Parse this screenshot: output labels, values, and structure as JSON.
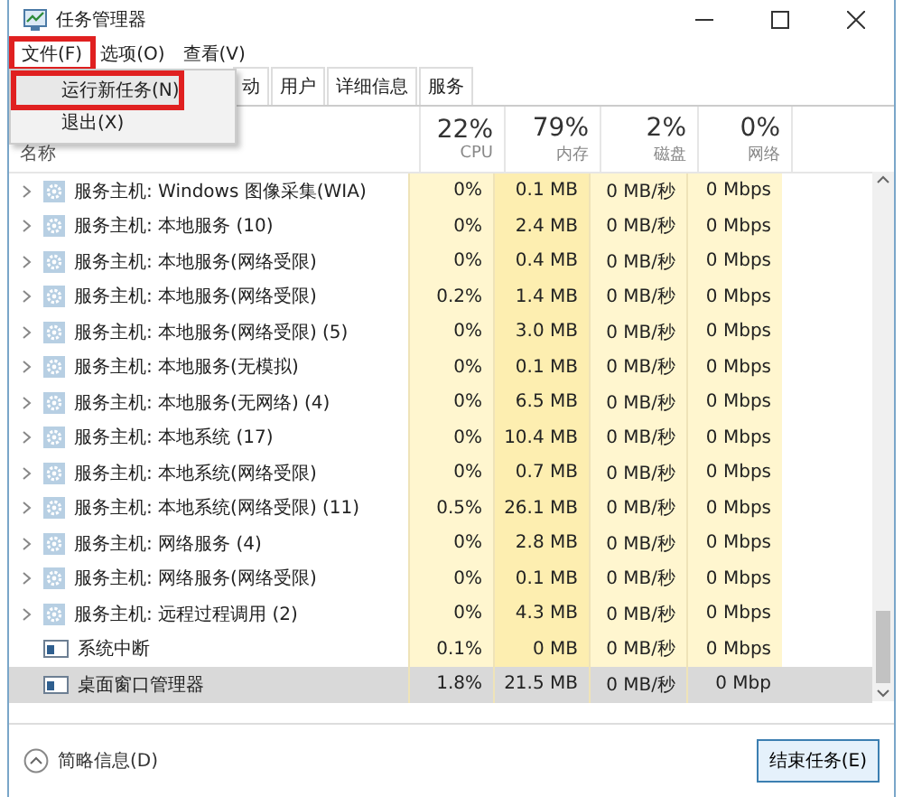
{
  "window": {
    "title": "任务管理器"
  },
  "menu": [
    {
      "label": "文件(F)",
      "selected": true
    },
    {
      "label": "选项(O)",
      "selected": false
    },
    {
      "label": "查看(V)",
      "selected": false
    }
  ],
  "file_menu": {
    "items": [
      {
        "label": "运行新任务(N)",
        "selected": true
      },
      {
        "label": "退出(X)",
        "selected": false
      }
    ]
  },
  "tabs": [
    {
      "label": "动",
      "selected": false
    },
    {
      "label": "用户",
      "selected": false
    },
    {
      "label": "详细信息",
      "selected": false
    },
    {
      "label": "服务",
      "selected": false
    }
  ],
  "table": {
    "name_column": "名称",
    "columns": [
      {
        "percent": "22%",
        "label": "CPU"
      },
      {
        "percent": "79%",
        "label": "内存"
      },
      {
        "percent": "2%",
        "label": "磁盘"
      },
      {
        "percent": "0%",
        "label": "网络"
      }
    ],
    "rows": [
      {
        "kind": "service",
        "name": "服务主机: Windows 图像采集(WIA)",
        "cells": [
          "0%",
          "0.1 MB",
          "0 MB/秒",
          "0 Mbps"
        ],
        "selected": false
      },
      {
        "kind": "service",
        "name": "服务主机: 本地服务 (10)",
        "cells": [
          "0%",
          "2.4 MB",
          "0 MB/秒",
          "0 Mbps"
        ],
        "selected": false
      },
      {
        "kind": "service",
        "name": "服务主机: 本地服务(网络受限)",
        "cells": [
          "0%",
          "0.4 MB",
          "0 MB/秒",
          "0 Mbps"
        ],
        "selected": false
      },
      {
        "kind": "service",
        "name": "服务主机: 本地服务(网络受限)",
        "cells": [
          "0.2%",
          "1.4 MB",
          "0 MB/秒",
          "0 Mbps"
        ],
        "selected": false
      },
      {
        "kind": "service",
        "name": "服务主机: 本地服务(网络受限) (5)",
        "cells": [
          "0%",
          "3.0 MB",
          "0 MB/秒",
          "0 Mbps"
        ],
        "selected": false
      },
      {
        "kind": "service",
        "name": "服务主机: 本地服务(无模拟)",
        "cells": [
          "0%",
          "0.1 MB",
          "0 MB/秒",
          "0 Mbps"
        ],
        "selected": false
      },
      {
        "kind": "service",
        "name": "服务主机: 本地服务(无网络) (4)",
        "cells": [
          "0%",
          "6.5 MB",
          "0 MB/秒",
          "0 Mbps"
        ],
        "selected": false
      },
      {
        "kind": "service",
        "name": "服务主机: 本地系统 (17)",
        "cells": [
          "0%",
          "10.4 MB",
          "0 MB/秒",
          "0 Mbps"
        ],
        "selected": false
      },
      {
        "kind": "service",
        "name": "服务主机: 本地系统(网络受限)",
        "cells": [
          "0%",
          "0.7 MB",
          "0 MB/秒",
          "0 Mbps"
        ],
        "selected": false
      },
      {
        "kind": "service",
        "name": "服务主机: 本地系统(网络受限) (11)",
        "cells": [
          "0.5%",
          "26.1 MB",
          "0 MB/秒",
          "0 Mbps"
        ],
        "selected": false
      },
      {
        "kind": "service",
        "name": "服务主机: 网络服务 (4)",
        "cells": [
          "0%",
          "2.8 MB",
          "0 MB/秒",
          "0 Mbps"
        ],
        "selected": false
      },
      {
        "kind": "service",
        "name": "服务主机: 网络服务(网络受限)",
        "cells": [
          "0%",
          "0.1 MB",
          "0 MB/秒",
          "0 Mbps"
        ],
        "selected": false
      },
      {
        "kind": "service",
        "name": "服务主机: 远程过程调用 (2)",
        "cells": [
          "0%",
          "4.3 MB",
          "0 MB/秒",
          "0 Mbps"
        ],
        "selected": false
      },
      {
        "kind": "process",
        "name": "系统中断",
        "cells": [
          "0.1%",
          "0 MB",
          "0 MB/秒",
          "0 Mbps"
        ],
        "selected": false
      },
      {
        "kind": "process",
        "name": "桌面窗口管理器",
        "cells": [
          "1.8%",
          "21.5 MB",
          "0 MB/秒",
          "0 Mbp"
        ],
        "selected": true
      }
    ]
  },
  "footer": {
    "details": "简略信息(D)",
    "end_task": "结束任务(E)"
  }
}
